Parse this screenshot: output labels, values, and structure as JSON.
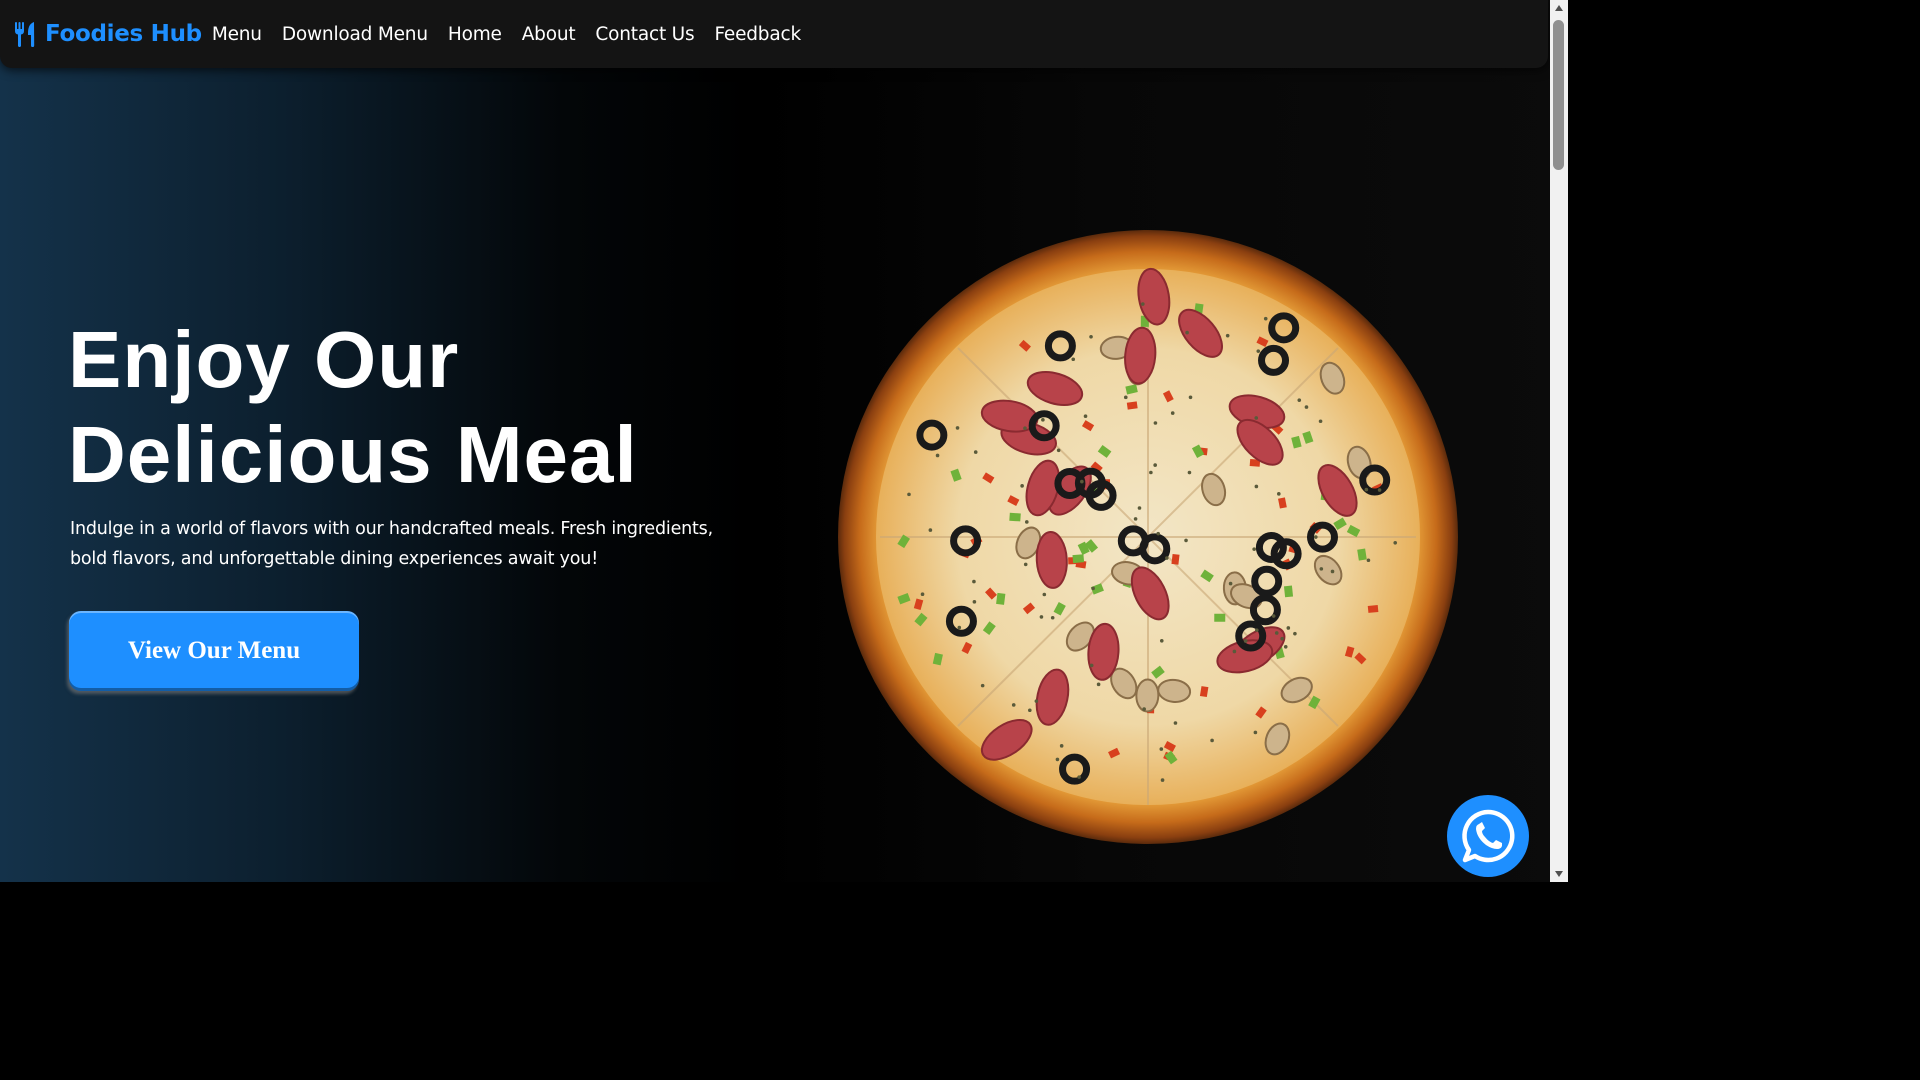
{
  "nav": {
    "brand": "Foodies Hub",
    "links": [
      "Menu",
      "Download Menu",
      "Home",
      "About",
      "Contact Us",
      "Feedback"
    ]
  },
  "hero": {
    "title_line1": "Enjoy Our",
    "title_line2": "Delicious Meal",
    "description": "Indulge in a world of flavors with our handcrafted meals. Fresh ingredients, bold flavors, and unforgettable dining experiences await you!",
    "cta_label": "View Our Menu",
    "image": "pizza"
  },
  "icons": {
    "brand": "utensils-icon",
    "chat": "whatsapp-icon"
  },
  "colors": {
    "accent": "#1e8fff",
    "navbar": "#141414",
    "text": "#ffffff"
  }
}
